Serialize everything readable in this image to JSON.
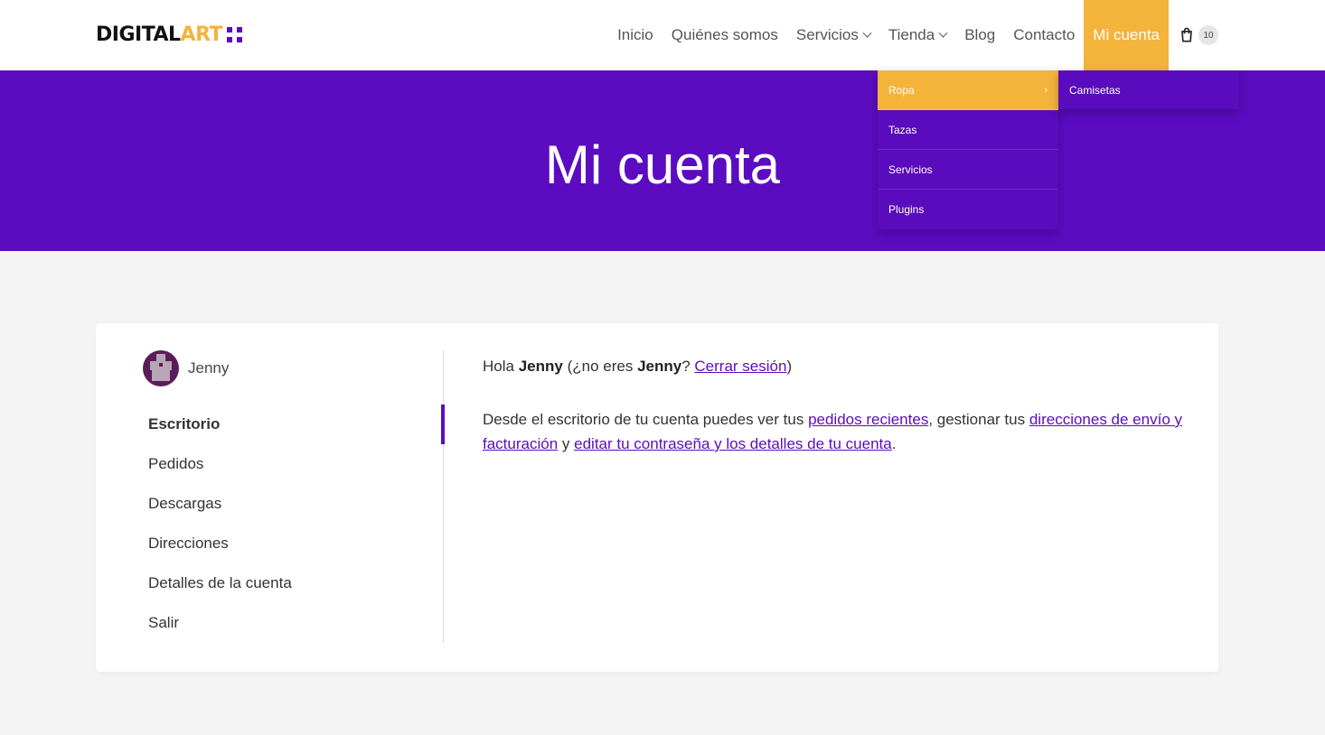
{
  "logo": {
    "part1": "DIGITAL",
    "part2": "ART"
  },
  "nav": {
    "items": [
      {
        "label": "Inicio"
      },
      {
        "label": "Quiénes somos"
      },
      {
        "label": "Servicios"
      },
      {
        "label": "Tienda"
      },
      {
        "label": "Blog"
      },
      {
        "label": "Contacto"
      },
      {
        "label": "Mi cuenta"
      }
    ],
    "cart_count": "10"
  },
  "dropdown": {
    "items": [
      "Ropa",
      "Tazas",
      "Servicios",
      "Plugins"
    ],
    "submenu": "Camisetas"
  },
  "hero": {
    "title": "Mi cuenta"
  },
  "account": {
    "username": "Jenny",
    "menu": [
      "Escritorio",
      "Pedidos",
      "Descargas",
      "Direcciones",
      "Detalles de la cuenta",
      "Salir"
    ],
    "greeting": {
      "hello": "Hola",
      "name": "Jenny",
      "not_you": "(¿no eres",
      "name2": "Jenny",
      "q": "?",
      "logout": "Cerrar sesión",
      "close": ")"
    },
    "intro": {
      "t1": "Desde el escritorio de tu cuenta puedes ver tus",
      "l1": "pedidos recientes",
      "t2": ", gestionar tus",
      "l2": "direcciones de envío y facturación",
      "t3": "y",
      "l3": "editar tu contraseña y los detalles de tu cuenta",
      "t4": "."
    }
  },
  "colors": {
    "primary": "#5b0cc0",
    "accent": "#f4b33b"
  }
}
